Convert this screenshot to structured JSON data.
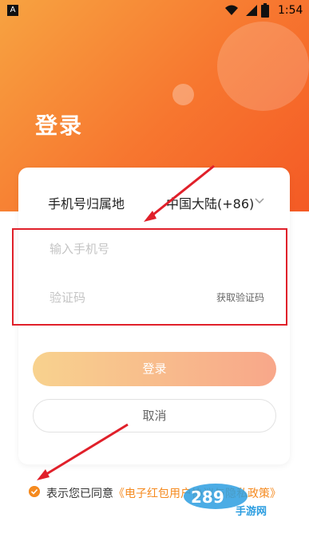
{
  "status_bar": {
    "app_icon": "A",
    "time": "1:54",
    "icons": [
      "wifi-icon",
      "signal-icon",
      "battery-icon"
    ]
  },
  "title": "登录",
  "form": {
    "region_label": "手机号归属地",
    "region_value": "中国大陆(+86)",
    "phone_placeholder": "输入手机号",
    "code_placeholder": "验证码",
    "get_code_label": "获取验证码"
  },
  "buttons": {
    "login": "登录",
    "cancel": "取消"
  },
  "agreement": {
    "prefix": "表示您已同意",
    "link": "《电子红包用户协议与隐私政策》"
  },
  "watermark": {
    "text": "手游网"
  },
  "colors": {
    "accent": "#f58a1f",
    "highlight": "#e0202a"
  }
}
